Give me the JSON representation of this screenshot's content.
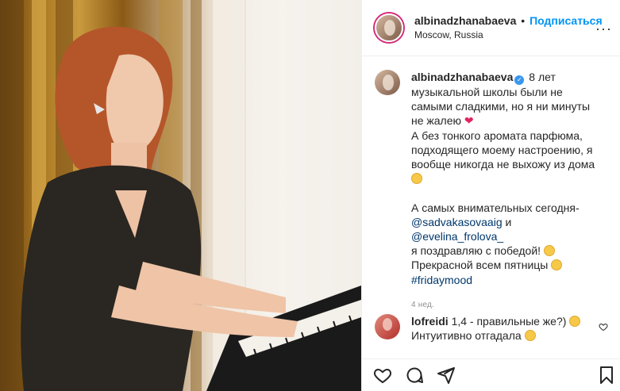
{
  "post": {
    "username": "albinadzhanabaeva",
    "dot": "•",
    "follow_label": "Подписаться",
    "location": "Moscow, Russia",
    "more": "···"
  },
  "caption": {
    "username": "albinadzhanabaeva",
    "verified_mark": "✓",
    "line1": "8 лет музыкальной школы были не самыми сладкими, но я ни минуты не жалею",
    "heart": "❤",
    "line2": "А без тонкого аромата парфюма, подходящего моему настроению, я вообще никогда не выхожу из дома",
    "line3_prefix": "А самых внимательных сегодня-",
    "mention1": "@sadvakasovaaig",
    "and": " и ",
    "mention2": "@evelina_frolova_",
    "line4": "я поздравляю с победой!",
    "line5": "Прекрасной всем пятницы",
    "hashtag": "#fridaymood",
    "timestamp": "4 нед."
  },
  "comment": {
    "username": "lofreidi",
    "text1": "1,4 - правильные же?)",
    "text2": "Интуитивно отгадала"
  },
  "actions": [
    "heart-outline-icon",
    "comment-icon",
    "share-icon",
    "bookmark-icon"
  ],
  "colors": {
    "accent": "#0095f6",
    "link": "#00376b",
    "verified": "#3897f0",
    "muted": "#8e8e8e"
  }
}
